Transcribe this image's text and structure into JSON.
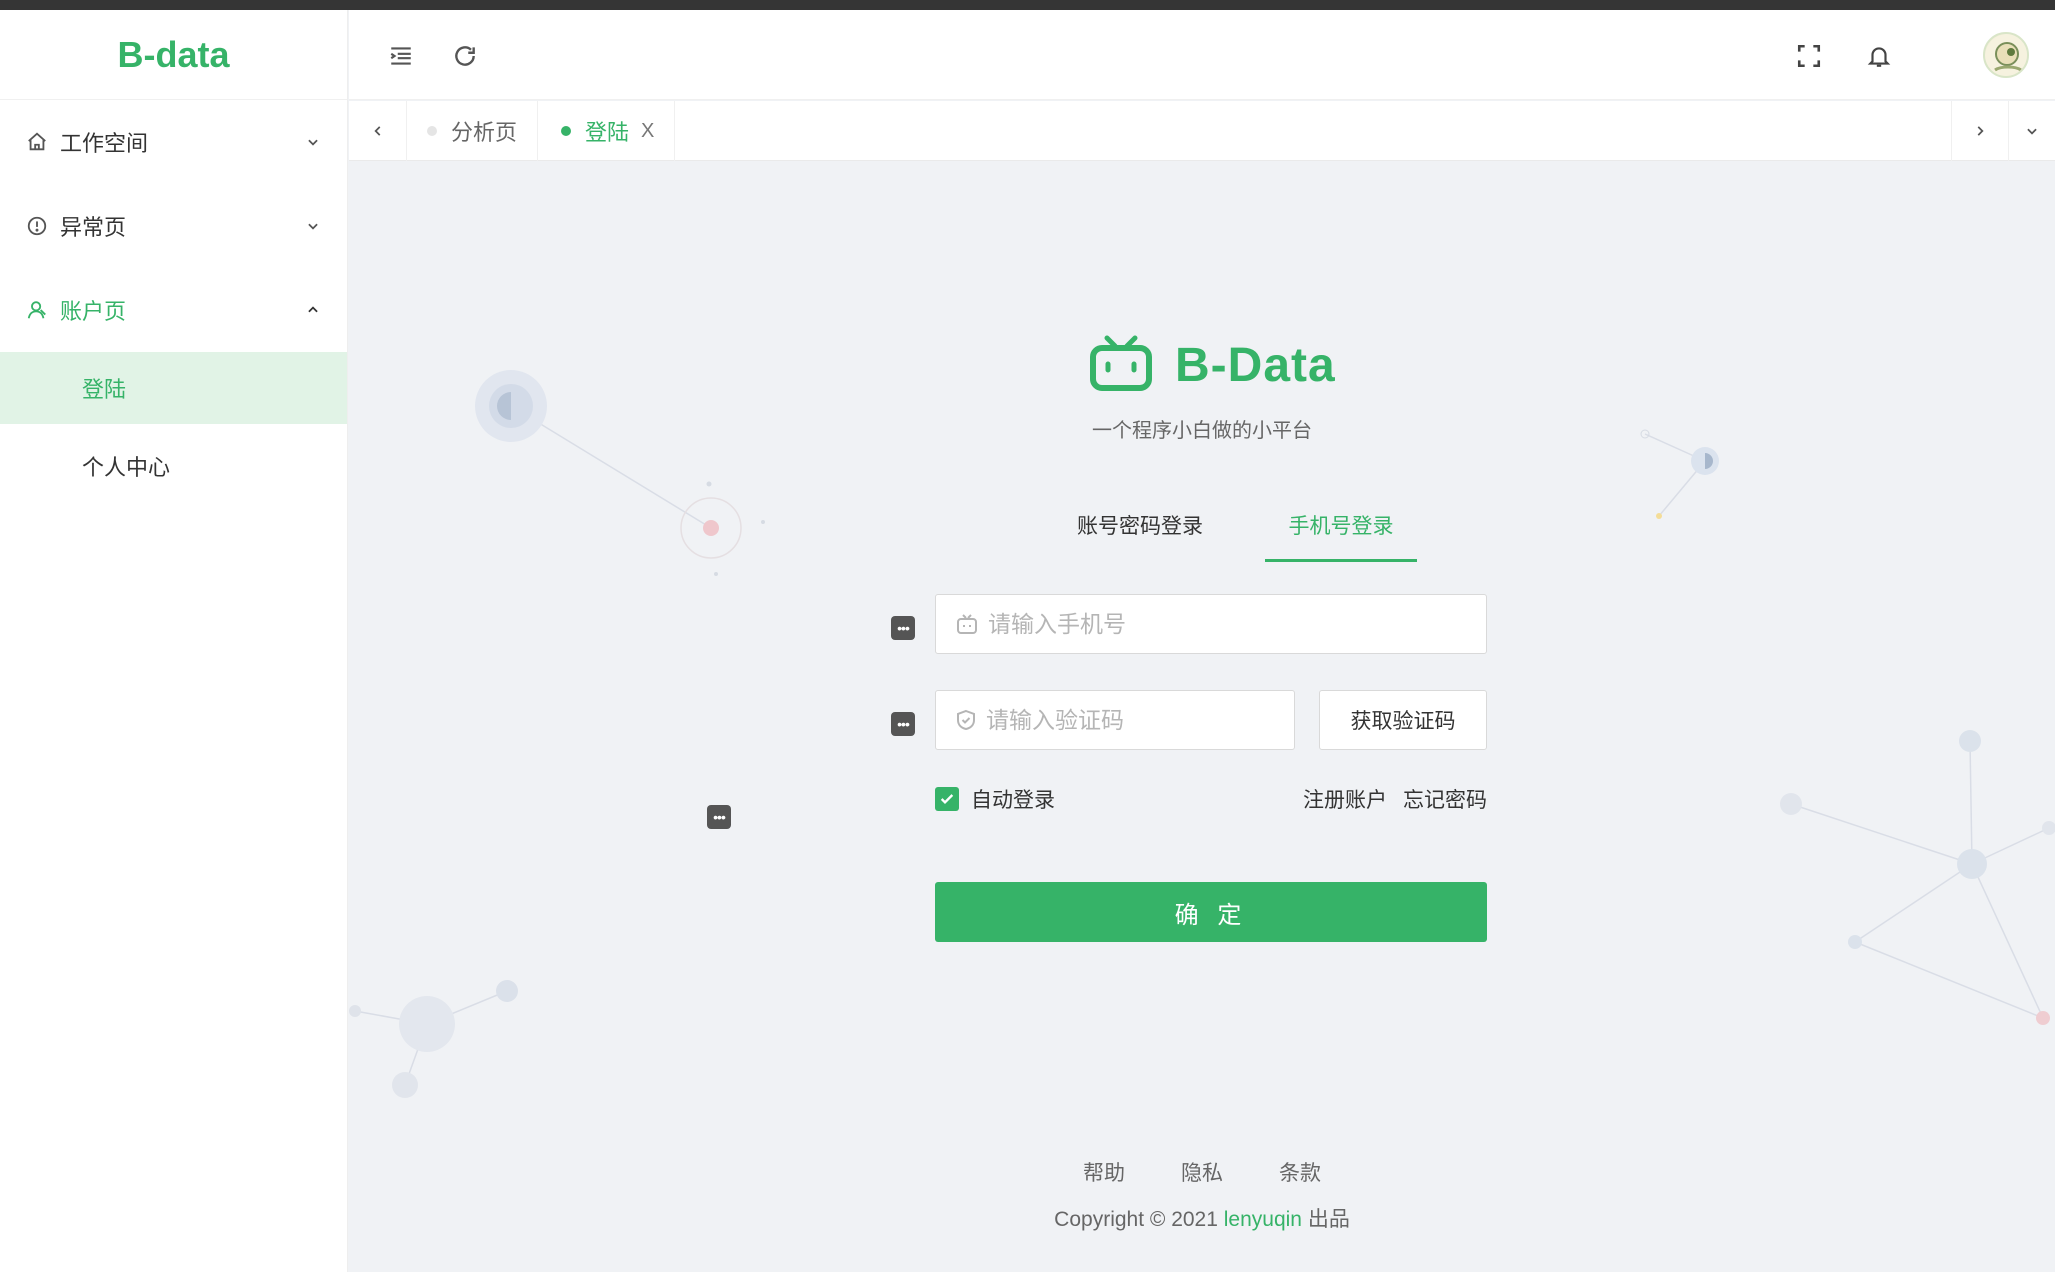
{
  "app": {
    "logo": "B-data",
    "accent": "#36b368"
  },
  "sidebar": {
    "items": [
      {
        "label": "工作空间",
        "icon": "home-icon",
        "arrow": "chevron-down-icon"
      },
      {
        "label": "异常页",
        "icon": "alert-circle-icon",
        "arrow": "chevron-down-icon"
      },
      {
        "label": "账户页",
        "icon": "user-icon",
        "arrow": "chevron-up-icon",
        "children": [
          {
            "label": "登陆"
          },
          {
            "label": "个人中心"
          }
        ]
      }
    ]
  },
  "header": {
    "icons": [
      "menu-fold-icon",
      "refresh-icon",
      "fullscreen-icon",
      "bell-icon"
    ]
  },
  "tabs": [
    {
      "label": "分析页",
      "active": false
    },
    {
      "label": "登陆",
      "active": true,
      "close": "X"
    }
  ],
  "login": {
    "brand_title": "B-Data",
    "brand_subtitle": "一个程序小白做的小平台",
    "tabs": [
      "账号密码登录",
      "手机号登录"
    ],
    "phone_placeholder": "请输入手机号",
    "code_placeholder": "请输入验证码",
    "get_code_label": "获取验证码",
    "remember_label": "自动登录",
    "register_label": "注册账户",
    "forgot_label": "忘记密码",
    "submit_label": "确 定"
  },
  "footer": {
    "links": [
      "帮助",
      "隐私",
      "条款"
    ],
    "copyright_prefix": "Copyright © 2021 ",
    "copyright_author": "lenyuqin",
    "copyright_suffix": " 出品"
  }
}
